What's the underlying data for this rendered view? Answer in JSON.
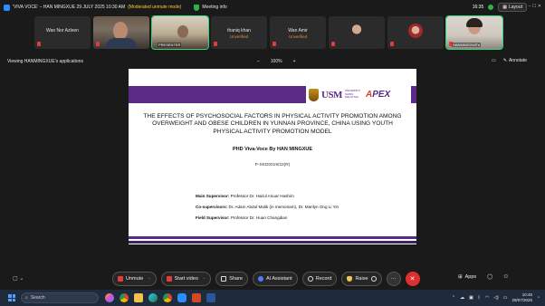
{
  "titlebar": {
    "title": "'VIVA VOCE' – HAN MINGXUE 29 JULY 2025 10:30 AM",
    "mode": "(Moderated unmute mode)",
    "meeting_info": "Meeting info",
    "clock": "16:35",
    "layout": "Layout",
    "window_controls": "–  ☐  ✕"
  },
  "participants": [
    {
      "name": "Wan Nor Azleen",
      "status": ""
    },
    {
      "name": "",
      "status": ""
    },
    {
      "name": "",
      "label": "PRESENTER",
      "status": ""
    },
    {
      "name": "thaniq khan",
      "status": "Unverified"
    },
    {
      "name": "Wan Amir",
      "status": "Unverified"
    },
    {
      "name": "",
      "status": ""
    },
    {
      "name": "",
      "status": ""
    },
    {
      "name": "HANMINGXUE's",
      "status": ""
    }
  ],
  "viewbar": {
    "viewing": "Viewing HANMINGXUE's applications",
    "zoom_minus": "–",
    "zoom_level": "100%",
    "zoom_plus": "+",
    "annotate": "Annotate"
  },
  "slide": {
    "usm": "USM",
    "usm_sub": "UNIVERSITI SAINS MALAYSIA",
    "apex_a": "A",
    "apex_rest": "PEX",
    "title": "THE EFFECTS OF PSYCHOSOCIAL FACTORS IN PHYSICAL ACTIVITY PROMOTION AMONG OVERWEIGHT AND OBESE CHILDREN IN YUNNAN PROVINCE, CHINA USING YOUTH PHYSICAL ACTIVITY PROMOTION MODEL",
    "phd": "PHD Viva-Voce By HAN MINGXUE",
    "code": "P-SKD0019/22(R)",
    "main_sup_label": "Main Supervisor:",
    "main_sup": "Professor Dr. Hairul Anuar Hashim",
    "co_sup_label": "Co-supervisors:",
    "co_sup": "Dr. Adam Abdul Malik (in memoriam), Dr. Marilyn Ong Li Yin",
    "field_sup_label": "Field Supervisor:",
    "field_sup": "Professor Dr. Huan Changdian"
  },
  "controls": {
    "cc": "▢ ⌄",
    "unmute": "Unmute",
    "start_video": "Start video",
    "share": "Share",
    "ai_assistant": "AI Assistant",
    "record": "Record",
    "raise": "Raise",
    "more": "···",
    "end": "✕",
    "apps": "Apps"
  },
  "taskbar": {
    "search_placeholder": "Search",
    "time": "10:46",
    "date": "29/07/2025"
  },
  "colors": {
    "accent_green": "#2fd67a",
    "slide_purple": "#5b2a86",
    "end_red": "#e02f2f"
  }
}
